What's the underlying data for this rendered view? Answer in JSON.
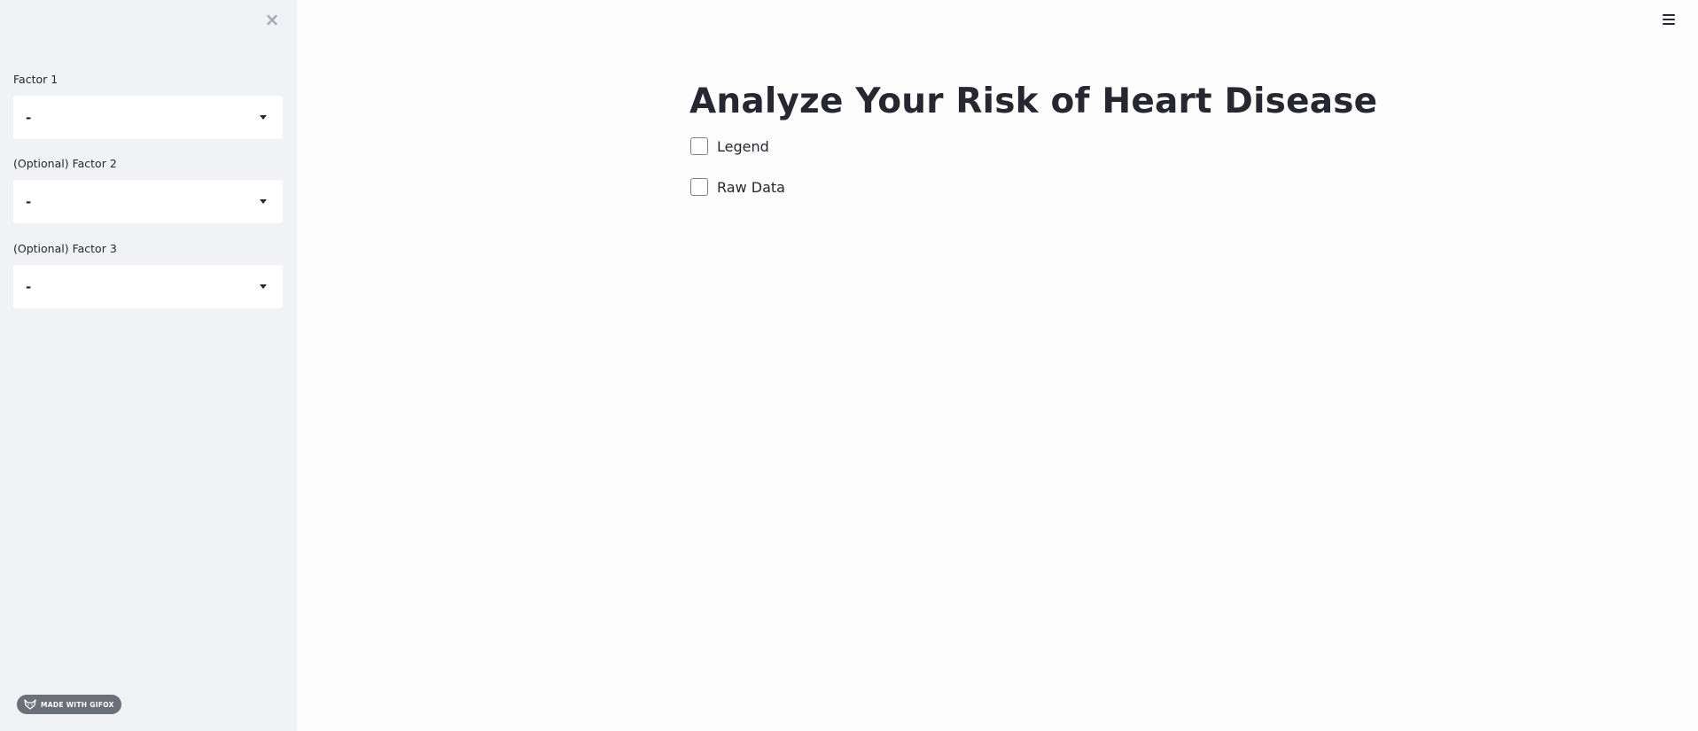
{
  "sidebar": {
    "close_symbol": "×",
    "fields": [
      {
        "label": "Factor 1",
        "value": "-"
      },
      {
        "label": "(Optional) Factor 2",
        "value": "-"
      },
      {
        "label": "(Optional) Factor 3",
        "value": "-"
      }
    ],
    "badge": {
      "icon": "fox-icon",
      "text": "MADE WITH GIFOX"
    }
  },
  "header": {
    "menu_icon": "hamburger-menu-icon"
  },
  "main": {
    "title": "Analyze Your Risk of Heart Disease",
    "checkboxes": [
      {
        "label": "Legend",
        "checked": false
      },
      {
        "label": "Raw Data",
        "checked": false
      }
    ]
  },
  "colors": {
    "sidebar_bg": "#f0f2f6",
    "main_bg": "#fdfdfe",
    "text": "#262730",
    "badge_bg": "#6b6f78"
  }
}
